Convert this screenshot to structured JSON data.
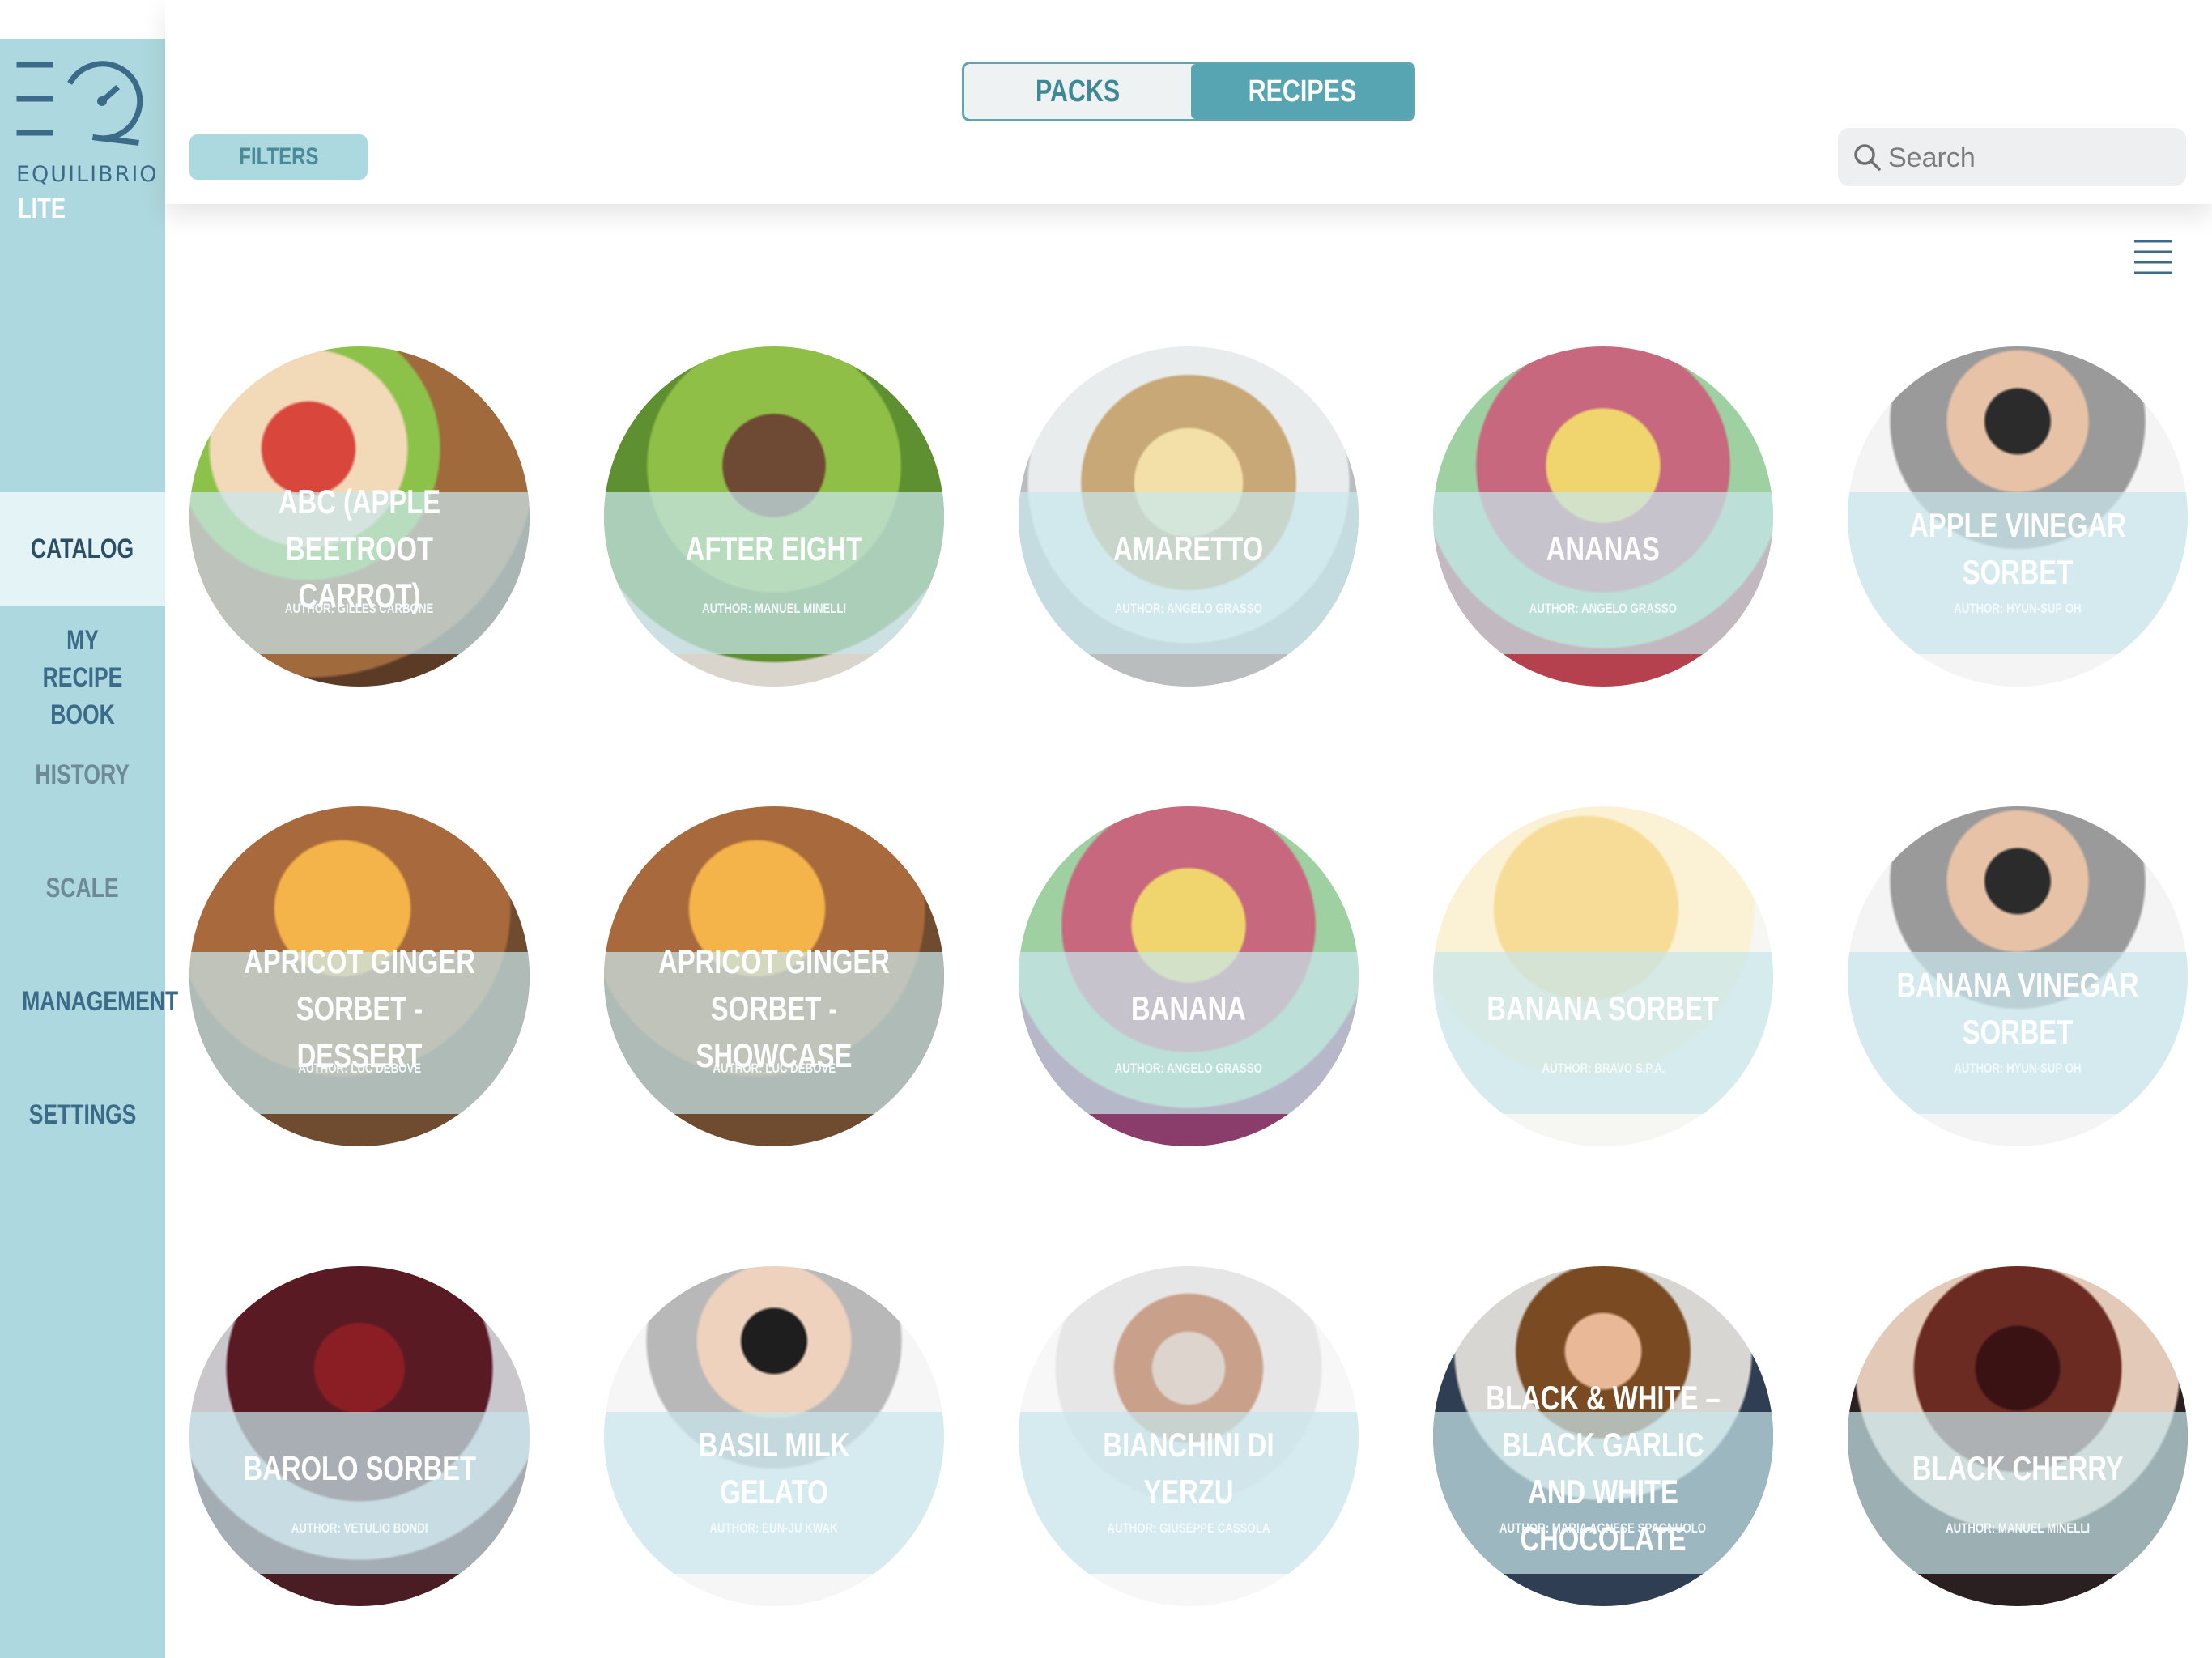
{
  "app": {
    "logo_text": "EQUILIBRIO",
    "edition": "LITE"
  },
  "sidebar": {
    "items": [
      {
        "label": "CATALOG"
      },
      {
        "label": "MY RECIPE BOOK"
      },
      {
        "label": "HISTORY"
      },
      {
        "label": "SCALE"
      },
      {
        "label": "MANAGEMENT"
      },
      {
        "label": "SETTINGS"
      }
    ]
  },
  "header": {
    "tabs": [
      {
        "label": "PACKS"
      },
      {
        "label": "RECIPES"
      }
    ],
    "filters_label": "FILTERS",
    "search_placeholder": "Search"
  },
  "recipes": [
    {
      "title": "ABC (APPLE BEETROOT CARROT)",
      "author": "AUTHOR: GILLES CARBONE"
    },
    {
      "title": "AFTER EIGHT",
      "author": "AUTHOR: MANUEL MINELLI"
    },
    {
      "title": "AMARETTO",
      "author": "AUTHOR: ANGELO GRASSO"
    },
    {
      "title": "ANANAS",
      "author": "AUTHOR: ANGELO GRASSO"
    },
    {
      "title": "APPLE VINEGAR SORBET",
      "author": "AUTHOR: HYUN-SUP OH"
    },
    {
      "title": "APRICOT GINGER SORBET - DESSERT",
      "author": "AUTHOR: LUC DEBOVE"
    },
    {
      "title": "APRICOT GINGER SORBET - SHOWCASE",
      "author": "AUTHOR: LUC DEBOVE"
    },
    {
      "title": "BANANA",
      "author": "AUTHOR: ANGELO GRASSO"
    },
    {
      "title": "BANANA SORBET",
      "author": "AUTHOR: BRAVO S.P.A."
    },
    {
      "title": "BANANA VINEGAR SORBET",
      "author": "AUTHOR: HYUN-SUP OH"
    },
    {
      "title": "BAROLO SORBET",
      "author": "AUTHOR: VETULIO BONDI"
    },
    {
      "title": "BASIL MILK GELATO",
      "author": "AUTHOR: EUN-JU KWAK"
    },
    {
      "title": "BIANCHINI DI YERZU",
      "author": "AUTHOR: GIUSEPPE CASSOLA"
    },
    {
      "title": "BLACK & WHITE – BLACK GARLIC AND WHITE CHOCOLATE",
      "author": "AUTHOR: MARIA AGNESE SPAGNUOLO"
    },
    {
      "title": "BLACK CHERRY",
      "author": "AUTHOR: MANUEL MINELLI"
    }
  ]
}
